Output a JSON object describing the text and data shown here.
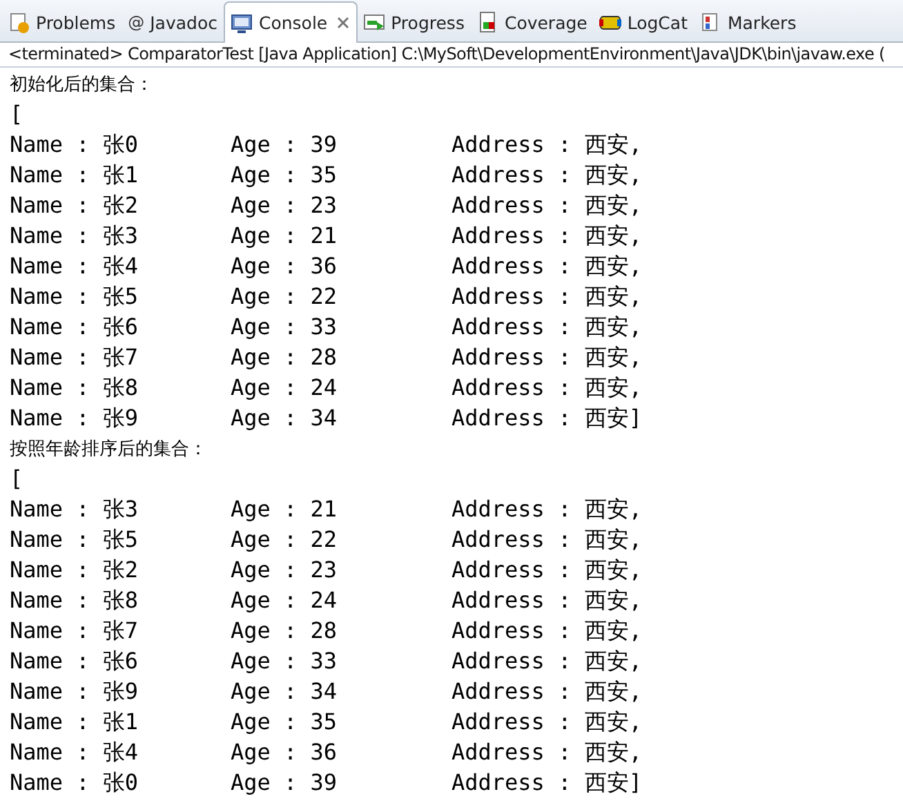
{
  "tabs": [
    {
      "label": "Problems",
      "kind": "problems",
      "selected": false
    },
    {
      "label": "Javadoc",
      "kind": "javadoc",
      "glyph": "@",
      "selected": false
    },
    {
      "label": "Console",
      "kind": "console",
      "selected": true
    },
    {
      "label": "Progress",
      "kind": "progress",
      "selected": false
    },
    {
      "label": "Coverage",
      "kind": "coverage",
      "selected": false
    },
    {
      "label": "LogCat",
      "kind": "logcat",
      "selected": false
    },
    {
      "label": "Markers",
      "kind": "markers",
      "selected": false
    }
  ],
  "console": {
    "status": "<terminated> ComparatorTest [Java Application] C:\\MySoft\\DevelopmentEnvironment\\Java\\JDK\\bin\\javaw.exe (",
    "blocks": [
      {
        "heading": "初始化后的集合：",
        "open": "[",
        "rows": [
          {
            "name": "Name : 张0",
            "age": "Age : 39",
            "address": "Address : 西安,"
          },
          {
            "name": "Name : 张1",
            "age": "Age : 35",
            "address": "Address : 西安,"
          },
          {
            "name": "Name : 张2",
            "age": "Age : 23",
            "address": "Address : 西安,"
          },
          {
            "name": "Name : 张3",
            "age": "Age : 21",
            "address": "Address : 西安,"
          },
          {
            "name": "Name : 张4",
            "age": "Age : 36",
            "address": "Address : 西安,"
          },
          {
            "name": "Name : 张5",
            "age": "Age : 22",
            "address": "Address : 西安,"
          },
          {
            "name": "Name : 张6",
            "age": "Age : 33",
            "address": "Address : 西安,"
          },
          {
            "name": "Name : 张7",
            "age": "Age : 28",
            "address": "Address : 西安,"
          },
          {
            "name": "Name : 张8",
            "age": "Age : 24",
            "address": "Address : 西安,"
          },
          {
            "name": "Name : 张9",
            "age": "Age : 34",
            "address": "Address : 西安]"
          }
        ]
      },
      {
        "heading": "按照年龄排序后的集合：",
        "open": "[",
        "rows": [
          {
            "name": "Name : 张3",
            "age": "Age : 21",
            "address": "Address : 西安,"
          },
          {
            "name": "Name : 张5",
            "age": "Age : 22",
            "address": "Address : 西安,"
          },
          {
            "name": "Name : 张2",
            "age": "Age : 23",
            "address": "Address : 西安,"
          },
          {
            "name": "Name : 张8",
            "age": "Age : 24",
            "address": "Address : 西安,"
          },
          {
            "name": "Name : 张7",
            "age": "Age : 28",
            "address": "Address : 西安,"
          },
          {
            "name": "Name : 张6",
            "age": "Age : 33",
            "address": "Address : 西安,"
          },
          {
            "name": "Name : 张9",
            "age": "Age : 34",
            "address": "Address : 西安,"
          },
          {
            "name": "Name : 张1",
            "age": "Age : 35",
            "address": "Address : 西安,"
          },
          {
            "name": "Name : 张4",
            "age": "Age : 36",
            "address": "Address : 西安,"
          },
          {
            "name": "Name : 张0",
            "age": "Age : 39",
            "address": "Address : 西安]"
          }
        ]
      }
    ]
  }
}
